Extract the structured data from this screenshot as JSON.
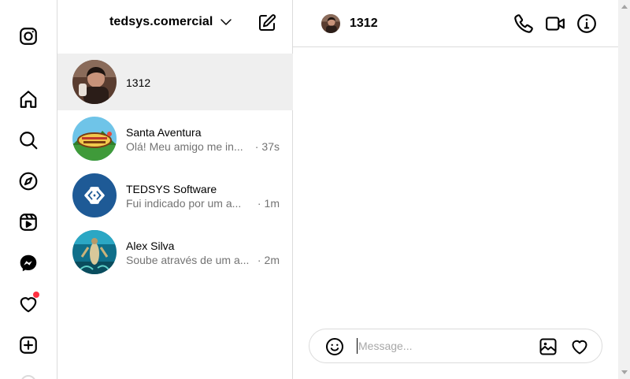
{
  "rail": {
    "items": [
      {
        "name": "instagram-logo-icon"
      },
      {
        "name": "home-icon"
      },
      {
        "name": "search-icon"
      },
      {
        "name": "explore-compass-icon"
      },
      {
        "name": "reels-icon"
      },
      {
        "name": "messenger-icon"
      },
      {
        "name": "notifications-heart-icon",
        "badge": true
      },
      {
        "name": "create-plus-icon"
      }
    ]
  },
  "inbox": {
    "account_name": "tedsys.comercial",
    "threads": [
      {
        "name": "1312",
        "preview": "",
        "time": "",
        "active": true
      },
      {
        "name": "Santa Aventura",
        "preview": "Olá! Meu amigo me in...",
        "time": "37s",
        "active": false
      },
      {
        "name": "TEDSYS Software",
        "preview": "Fui indicado por um a...",
        "time": "1m",
        "active": false
      },
      {
        "name": "Alex Silva",
        "preview": "Soube através de um a...",
        "time": "2m",
        "active": false
      }
    ]
  },
  "conversation": {
    "peer_name": "1312",
    "composer": {
      "placeholder": "Message..."
    }
  },
  "colors": {
    "border": "#dbdbdb",
    "active_thread_bg": "#efefef",
    "secondary_text": "#737373",
    "notification": "#ff3040",
    "tedsys_brand": "#1e5a96"
  }
}
